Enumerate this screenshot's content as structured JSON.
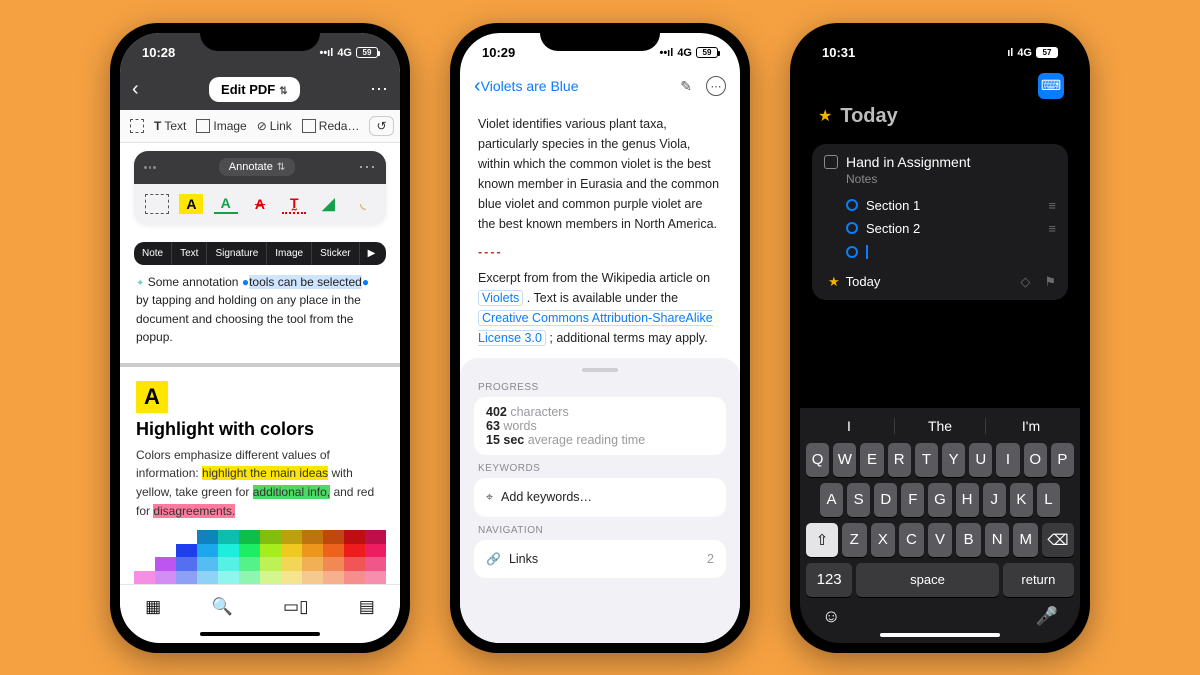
{
  "phone1": {
    "status": {
      "time": "10:28",
      "net": "4G",
      "battery": "59"
    },
    "nav": {
      "title": "Edit PDF"
    },
    "toolbar": {
      "select_region": true,
      "text": "Text",
      "image": "Image",
      "link": "Link",
      "redact": "Reda…"
    },
    "annotate_panel": {
      "title": "Annotate",
      "tools_glyph": "A"
    },
    "context_menu": [
      "Note",
      "Text",
      "Signature",
      "Image",
      "Sticker",
      "▶"
    ],
    "body_before": "Some annotation ",
    "body_selected": "tools can be selected",
    "body_after": " by tapping and holding on any place in the document and choosing the tool from the popup.",
    "section": {
      "icon_letter": "A",
      "heading": "Highlight with colors",
      "para_lead": "Colors emphasize different values of information: ",
      "hl_yellow": "highlight the main ideas",
      "mid1": " with yellow, take green for ",
      "hl_green": "additional info,",
      "mid2": " and red for ",
      "hl_red": "disagreements."
    }
  },
  "phone2": {
    "status": {
      "time": "10:29",
      "net": "4G",
      "battery": "59"
    },
    "back_title": "Violets are Blue",
    "paragraph": "Violet identifies various plant taxa, particularly species in the genus Viola, within which the common violet is the best known member in Eurasia and the common blue violet and common purple violet are the best known members in North America.",
    "divider": "----",
    "excerpt_lead": "Excerpt from from the Wikipedia article on ",
    "link_violets": "Violets",
    "excerpt_mid": " . Text is available under the ",
    "link_license": "Creative Commons Attribution-ShareAlike License 3.0",
    "excerpt_tail": " ; additional terms may apply.",
    "progress_label": "PROGRESS",
    "progress": {
      "chars_n": "402",
      "chars_l": "characters",
      "words_n": "63",
      "words_l": "words",
      "time_n": "15 sec",
      "time_l": "average reading time"
    },
    "keywords_label": "KEYWORDS",
    "keywords_placeholder": "Add keywords…",
    "navigation_label": "NAVIGATION",
    "links_label": "Links",
    "links_count": "2"
  },
  "phone3": {
    "status": {
      "time": "10:31",
      "net": "4G",
      "battery": "57"
    },
    "title": "Today",
    "task": {
      "title": "Hand in Assignment",
      "notes_label": "Notes",
      "sections": [
        "Section 1",
        "Section 2"
      ],
      "assoc_label": "Today"
    },
    "predictions": [
      "I",
      "The",
      "I'm"
    ],
    "rows": [
      [
        "Q",
        "W",
        "E",
        "R",
        "T",
        "Y",
        "U",
        "I",
        "O",
        "P"
      ],
      [
        "A",
        "S",
        "D",
        "F",
        "G",
        "H",
        "J",
        "K",
        "L"
      ],
      [
        "Z",
        "X",
        "C",
        "V",
        "B",
        "N",
        "M"
      ]
    ],
    "keys": {
      "shift": "⇧",
      "del": "⌫",
      "num": "123",
      "space": "space",
      "return": "return"
    }
  }
}
